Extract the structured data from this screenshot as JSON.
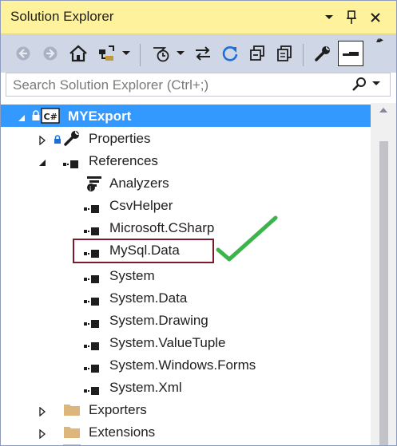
{
  "window": {
    "title": "Solution Explorer",
    "title_controls": [
      "dropdown-arrow",
      "pin",
      "close"
    ]
  },
  "toolbar": {
    "buttons": [
      "back",
      "forward",
      "home",
      "switch-views",
      "pending-changes-filter",
      "sync-with-active-document",
      "refresh",
      "collapse-all",
      "show-all-files",
      "properties",
      "preview-selected-items"
    ]
  },
  "search": {
    "placeholder": "Search Solution Explorer (Ctrl+;)"
  },
  "tree": {
    "project": {
      "label": "MYExport",
      "icon": "csharp-project-icon",
      "selected": true
    },
    "properties": {
      "label": "Properties",
      "icon": "wrench-icon"
    },
    "references": {
      "label": "References",
      "items": [
        {
          "label": "Analyzers",
          "icon": "analyzers-icon"
        },
        {
          "label": "CsvHelper",
          "icon": "reference-icon"
        },
        {
          "label": "Microsoft.CSharp",
          "icon": "reference-icon"
        },
        {
          "label": "MySql.Data",
          "icon": "reference-icon",
          "highlighted": true
        },
        {
          "label": "System",
          "icon": "reference-icon"
        },
        {
          "label": "System.Data",
          "icon": "reference-icon"
        },
        {
          "label": "System.Drawing",
          "icon": "reference-icon"
        },
        {
          "label": "System.ValueTuple",
          "icon": "reference-icon"
        },
        {
          "label": "System.Windows.Forms",
          "icon": "reference-icon"
        },
        {
          "label": "System.Xml",
          "icon": "reference-icon"
        }
      ]
    },
    "folders": [
      {
        "label": "Exporters",
        "icon": "folder-icon"
      },
      {
        "label": "Extensions",
        "icon": "folder-icon"
      }
    ]
  },
  "colors": {
    "title_bar": "#fff29d",
    "toolbar": "#cfd6e5",
    "selection": "#3399ff",
    "annotation_box": "#7d1a2a",
    "annotation_check": "#3cb44b"
  }
}
